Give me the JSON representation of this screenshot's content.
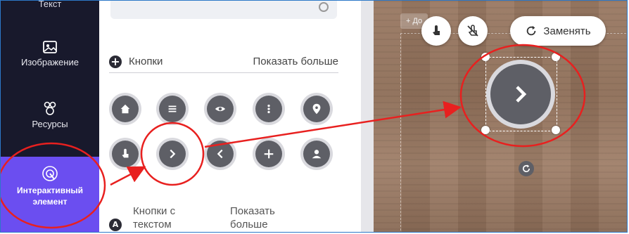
{
  "nav": {
    "top_label": "Текст",
    "items": [
      {
        "label": "Изображение",
        "icon": "image-icon"
      },
      {
        "label": "Ресурсы",
        "icon": "shapes-icon"
      }
    ],
    "active": {
      "label_line1": "Интерактивный",
      "label_line2": "элемент",
      "icon": "touch-target-icon"
    }
  },
  "panel": {
    "section1": {
      "title": "Кнопки",
      "show_more": "Показать больше"
    },
    "buttons": [
      {
        "icon": "home-icon"
      },
      {
        "icon": "menu-icon"
      },
      {
        "icon": "eye-icon"
      },
      {
        "icon": "more-vertical-icon"
      },
      {
        "icon": "location-pin-icon"
      },
      {
        "icon": "tap-hand-icon"
      },
      {
        "icon": "chevron-right-icon"
      },
      {
        "icon": "chevron-left-icon"
      },
      {
        "icon": "plus-icon"
      },
      {
        "icon": "user-icon"
      }
    ],
    "section2": {
      "badge": "A",
      "title_line1": "Кнопки с",
      "title_line2": "текстом",
      "more_line1": "Показать",
      "more_line2": "больше"
    }
  },
  "canvas": {
    "add_chip": "+ До",
    "toolbar": {
      "replace_label": "Заменять"
    }
  },
  "colors": {
    "nav_bg": "#18192c",
    "nav_active": "#6b4ef0",
    "button_fill": "#5e5f66",
    "annotation": "#e8201f",
    "frame": "#2c78c8"
  }
}
